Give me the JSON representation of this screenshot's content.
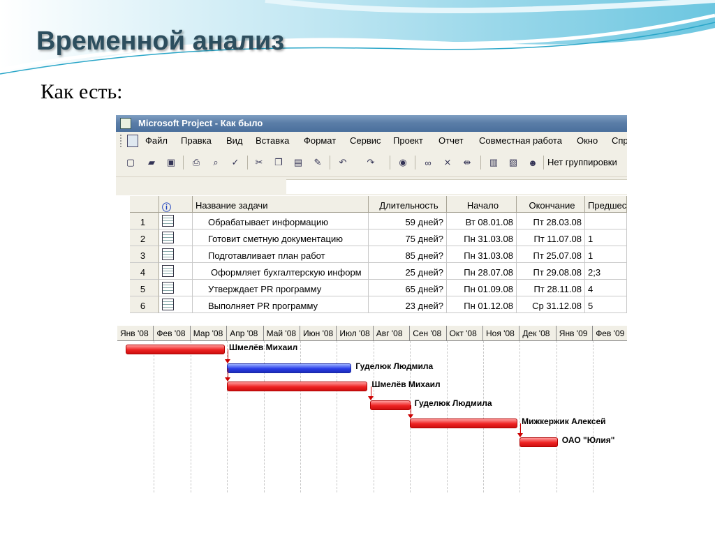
{
  "slide": {
    "title": "Временной анализ",
    "subtitle": "Как есть:"
  },
  "window": {
    "title": "Microsoft Project - Как было"
  },
  "menu": [
    "Файл",
    "Правка",
    "Вид",
    "Вставка",
    "Формат",
    "Сервис",
    "Проект",
    "Отчет",
    "Совместная работа",
    "Окно",
    "Спр"
  ],
  "toolbar": {
    "icons": [
      "new-icon",
      "open-icon",
      "save-icon",
      "print-icon",
      "print-preview-icon",
      "spelling-icon",
      "cut-icon",
      "copy-icon",
      "paste-icon",
      "format-painter-icon",
      "undo-icon",
      "redo-icon",
      "hyperlink-icon",
      "link-tasks-icon",
      "unlink-tasks-icon",
      "split-task-icon",
      "task-information-icon",
      "task-notes-icon",
      "assign-resources-icon"
    ],
    "grouping_label": "Нет группировки"
  },
  "table": {
    "columns": [
      "Название задачи",
      "Длительность",
      "Начало",
      "Окончание",
      "Предшес"
    ],
    "info_icon": "info-icon",
    "rows": [
      {
        "id": "1",
        "name": "Обрабатывает информацию",
        "duration": "59 дней?",
        "start": "Вт 08.01.08",
        "finish": "Пт 28.03.08",
        "pred": ""
      },
      {
        "id": "2",
        "name": "Готовит сметную документацию",
        "duration": "75 дней?",
        "start": "Пн 31.03.08",
        "finish": "Пт 11.07.08",
        "pred": "1"
      },
      {
        "id": "3",
        "name": "Подготавливает план работ",
        "duration": "85 дней?",
        "start": "Пн 31.03.08",
        "finish": "Пт 25.07.08",
        "pred": "1"
      },
      {
        "id": "4",
        "name": "Оформляет бухгалтерскую информ",
        "duration": "25 дней?",
        "start": "Пн 28.07.08",
        "finish": "Пт 29.08.08",
        "pred": "2;3"
      },
      {
        "id": "5",
        "name": "Утверждает PR программу",
        "duration": "65 дней?",
        "start": "Пн 01.09.08",
        "finish": "Пт 28.11.08",
        "pred": "4"
      },
      {
        "id": "6",
        "name": "Выполняет PR программу",
        "duration": "23 дней?",
        "start": "Пн 01.12.08",
        "finish": "Ср 31.12.08",
        "pred": "5"
      }
    ]
  },
  "gantt": {
    "months": [
      "Янв '08",
      "Фев '08",
      "Мар '08",
      "Апр '08",
      "Май '08",
      "Июн '08",
      "Июл '08",
      "Авг '08",
      "Сен '08",
      "Окт '08",
      "Ноя '08",
      "Дек '08",
      "Янв '09",
      "Фев '09"
    ],
    "bars": [
      {
        "start_month": 0.23,
        "end_month": 2.9,
        "color": "#ee2222",
        "resource": "Шмелёв Михаил"
      },
      {
        "start_month": 3.0,
        "end_month": 6.36,
        "color": "#2a3ee8",
        "resource": "Гуделюк Людмила"
      },
      {
        "start_month": 3.0,
        "end_month": 6.8,
        "color": "#ee2222",
        "resource": "Шмелёв Михаил"
      },
      {
        "start_month": 6.9,
        "end_month": 7.97,
        "color": "#ee2222",
        "resource": "Гуделюк Людмила"
      },
      {
        "start_month": 8.0,
        "end_month": 10.9,
        "color": "#ee2222",
        "resource": "Мижкержик Алексей"
      },
      {
        "start_month": 11.0,
        "end_month": 12.0,
        "color": "#ee2222",
        "resource": "ОАО \"Юлия\""
      }
    ]
  }
}
